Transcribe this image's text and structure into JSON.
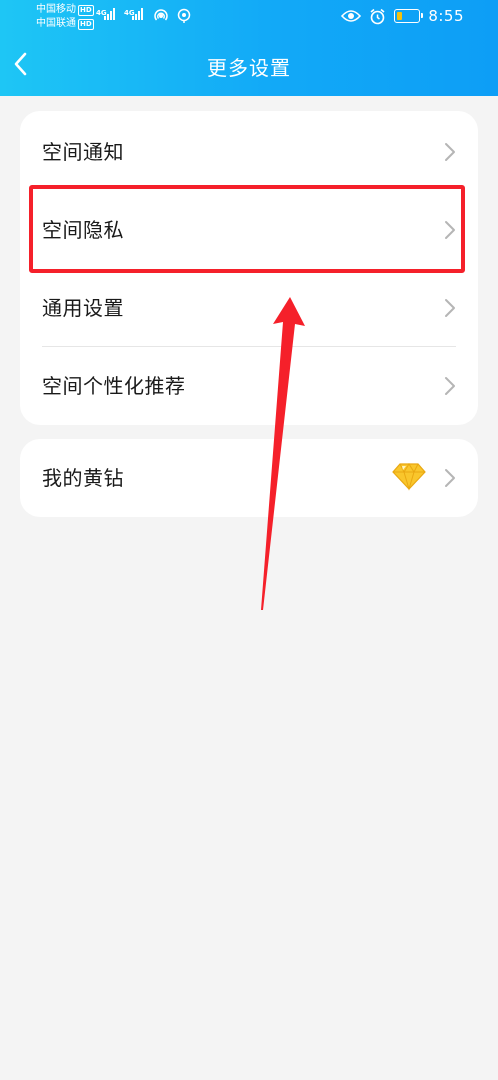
{
  "status_bar": {
    "carrier_1": "中国移动",
    "carrier_2": "中国联通",
    "hd_badge": "HD",
    "network_1": "4G",
    "network_2": "4G",
    "time": "8:55",
    "icons": [
      "eye-icon",
      "alarm-icon",
      "battery-icon",
      "wifi-hotspot-icon",
      "nfc-icon"
    ]
  },
  "header": {
    "title": "更多设置",
    "back_icon": "chevron-left-icon"
  },
  "settings_group_1": [
    {
      "label": "空间通知"
    },
    {
      "label": "空间隐私"
    },
    {
      "label": "通用设置"
    },
    {
      "label": "空间个性化推荐"
    }
  ],
  "settings_group_2": [
    {
      "label": "我的黄钻",
      "icon": "yellow-diamond-icon"
    }
  ],
  "colors": {
    "header_gradient_start": "#1ec6f5",
    "header_gradient_end": "#0d9ef6",
    "background": "#f4f4f4",
    "highlight_red": "#f5202a",
    "diamond_yellow": "#f9c62c"
  }
}
